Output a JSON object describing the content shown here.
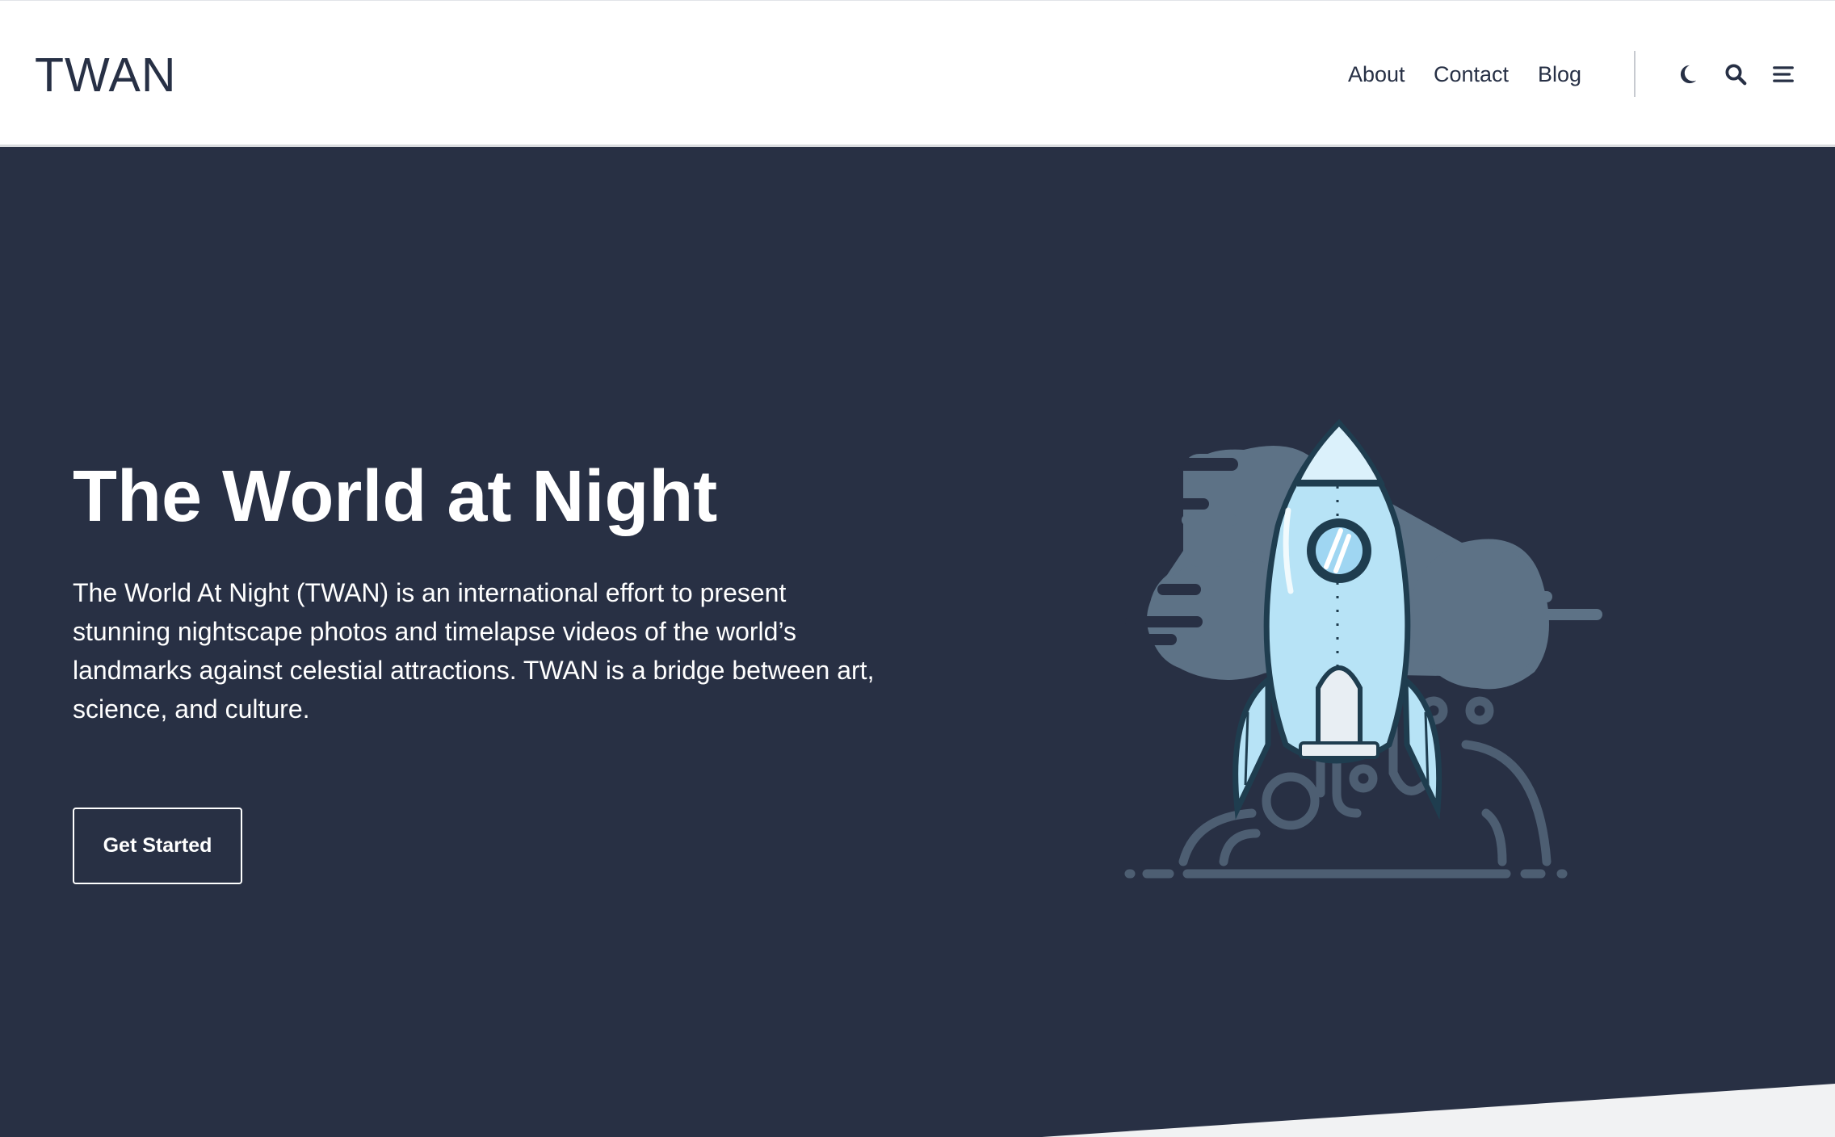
{
  "header": {
    "logo": "TWAN",
    "nav": [
      {
        "label": "About"
      },
      {
        "label": "Contact"
      },
      {
        "label": "Blog"
      }
    ],
    "icons": [
      "moon-icon",
      "search-icon",
      "menu-icon"
    ]
  },
  "hero": {
    "title": "The World at Night",
    "description": "The World At Night (TWAN) is an international effort to present stunning nightscape photos and timelapse videos of the world’s landmarks against celestial attractions. TWAN is a bridge between art, science, and culture.",
    "cta_label": "Get Started",
    "illustration": "rocket-launch-illustration"
  },
  "colors": {
    "hero_background": "#283044",
    "text_dark": "#273045",
    "cloud": "#5d7286",
    "rocket_body": "#b7e3f6",
    "rocket_outline": "#1f3d4f"
  }
}
